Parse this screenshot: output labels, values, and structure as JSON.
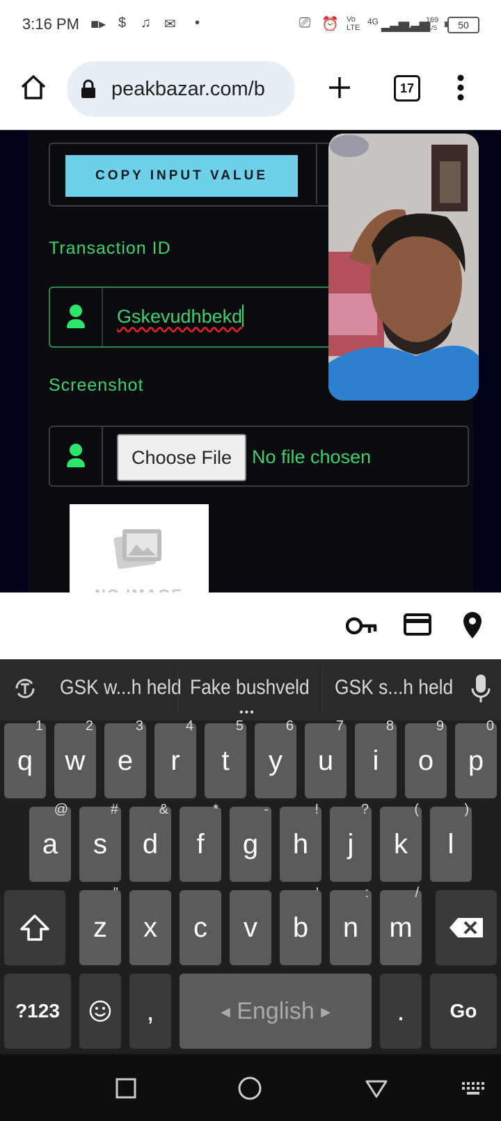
{
  "status_bar": {
    "time": "3:16 PM",
    "battery": "50",
    "speed_top": "169",
    "speed_bottom": "K/S",
    "volte": "Vo LTE",
    "net": "4G"
  },
  "browser": {
    "url": "peakbazar.com/b",
    "tab_count": "17"
  },
  "page": {
    "copy_button_label": "COPY INPUT VALUE",
    "transaction_label": "Transaction ID",
    "transaction_value": "Gskevudhbekd",
    "screenshot_label": "Screenshot",
    "choose_file_label": "Choose File",
    "no_file_text": "No file chosen",
    "no_image_text": "NO IMAGE"
  },
  "keyboard": {
    "suggestions": [
      "GSK w...h held",
      "Fake bushveld",
      "GSK s...h held"
    ],
    "row1": [
      {
        "k": "q",
        "h": "1"
      },
      {
        "k": "w",
        "h": "2"
      },
      {
        "k": "e",
        "h": "3"
      },
      {
        "k": "r",
        "h": "4"
      },
      {
        "k": "t",
        "h": "5"
      },
      {
        "k": "y",
        "h": "6"
      },
      {
        "k": "u",
        "h": "7"
      },
      {
        "k": "i",
        "h": "8"
      },
      {
        "k": "o",
        "h": "9"
      },
      {
        "k": "p",
        "h": "0"
      }
    ],
    "row2": [
      {
        "k": "a",
        "h": "@"
      },
      {
        "k": "s",
        "h": "#"
      },
      {
        "k": "d",
        "h": "&"
      },
      {
        "k": "f",
        "h": "*"
      },
      {
        "k": "g",
        "h": "-"
      },
      {
        "k": "h",
        "h": "!"
      },
      {
        "k": "j",
        "h": "?"
      },
      {
        "k": "k",
        "h": "("
      },
      {
        "k": "l",
        "h": ")"
      }
    ],
    "row3": [
      {
        "k": "z",
        "h": "\""
      },
      {
        "k": "x",
        "h": ""
      },
      {
        "k": "c",
        "h": ""
      },
      {
        "k": "v",
        "h": ""
      },
      {
        "k": "b",
        "h": "'"
      },
      {
        "k": "n",
        "h": ":"
      },
      {
        "k": "m",
        "h": "/"
      }
    ],
    "symbols_label": "?123",
    "comma": ",",
    "space_label": "English",
    "period": ".",
    "go_label": "Go"
  },
  "colors": {
    "accent_green": "#3bd36b",
    "copy_button": "#6fd0ea",
    "page_bg": "#0a0b10"
  }
}
